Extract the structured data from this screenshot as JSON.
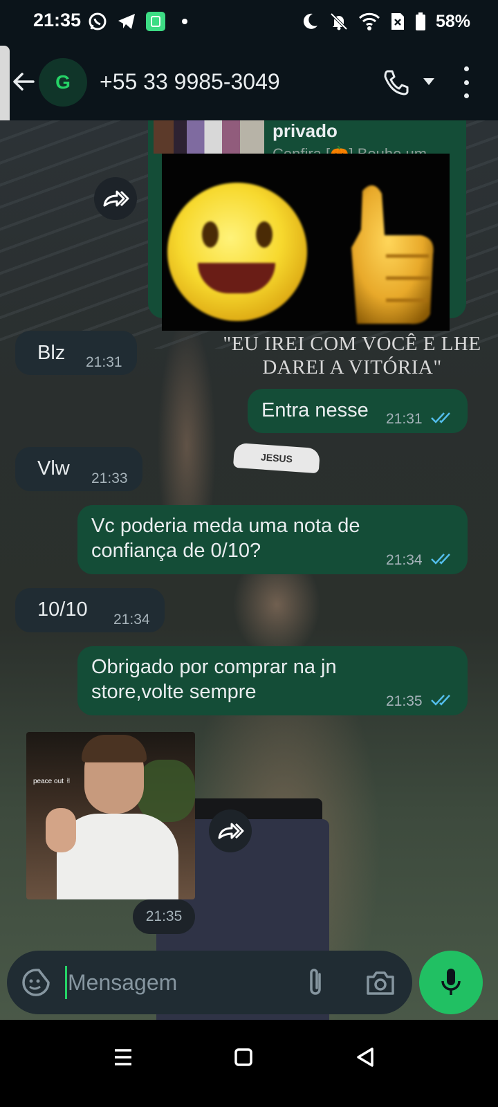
{
  "status_bar": {
    "time": "21:35",
    "battery_percent": "58%",
    "left_icons": [
      "whatsapp-icon",
      "telegram-icon",
      "app-icon",
      "dot-icon"
    ],
    "right_icons": [
      "moon-icon",
      "bell-off-icon",
      "wifi-icon",
      "no-sim-icon",
      "battery-icon"
    ]
  },
  "header": {
    "avatar_letter": "G",
    "contact": "+55 33 9985-3049",
    "colors": {
      "avatar_bg": "#103529",
      "avatar_fg": "#25d366"
    }
  },
  "wallpaper": {
    "quote_line1": "\"EU IREI COM VOCÊ E LHE",
    "quote_line2": "DAREI A VITÓRIA\"",
    "headband_text": "JESUS"
  },
  "messages": [
    {
      "type": "link",
      "direction": "out",
      "title": "privado",
      "description": "Confira [🎃] Bouhe um"
    },
    {
      "type": "sticker",
      "direction": "out",
      "sticker": "smiley-thumbs-up"
    },
    {
      "type": "text",
      "direction": "in",
      "text": "Blz",
      "time": "21:31"
    },
    {
      "type": "text",
      "direction": "out",
      "text": "Entra nesse",
      "time": "21:31",
      "read": true
    },
    {
      "type": "text",
      "direction": "in",
      "text": "Vlw",
      "time": "21:33"
    },
    {
      "type": "text",
      "direction": "out",
      "text_line1": "Vc poderia meda uma nota de",
      "text_line2": "confiança de 0/10?",
      "time": "21:34",
      "read": true
    },
    {
      "type": "text",
      "direction": "in",
      "text": "10/10",
      "time": "21:34"
    },
    {
      "type": "text",
      "direction": "out",
      "text_line1": "Obrigado por comprar na jn",
      "text_line2": "store,volte sempre",
      "time": "21:35",
      "read": true
    },
    {
      "type": "image",
      "direction": "in",
      "caption": "peace out ✌",
      "time": "21:35"
    }
  ],
  "composer": {
    "placeholder": "Mensagem",
    "value": ""
  },
  "colors": {
    "incoming_bubble": "#202c33",
    "outgoing_bubble": "#144d37",
    "accent": "#21c063",
    "read_ticks": "#53bdeb"
  }
}
